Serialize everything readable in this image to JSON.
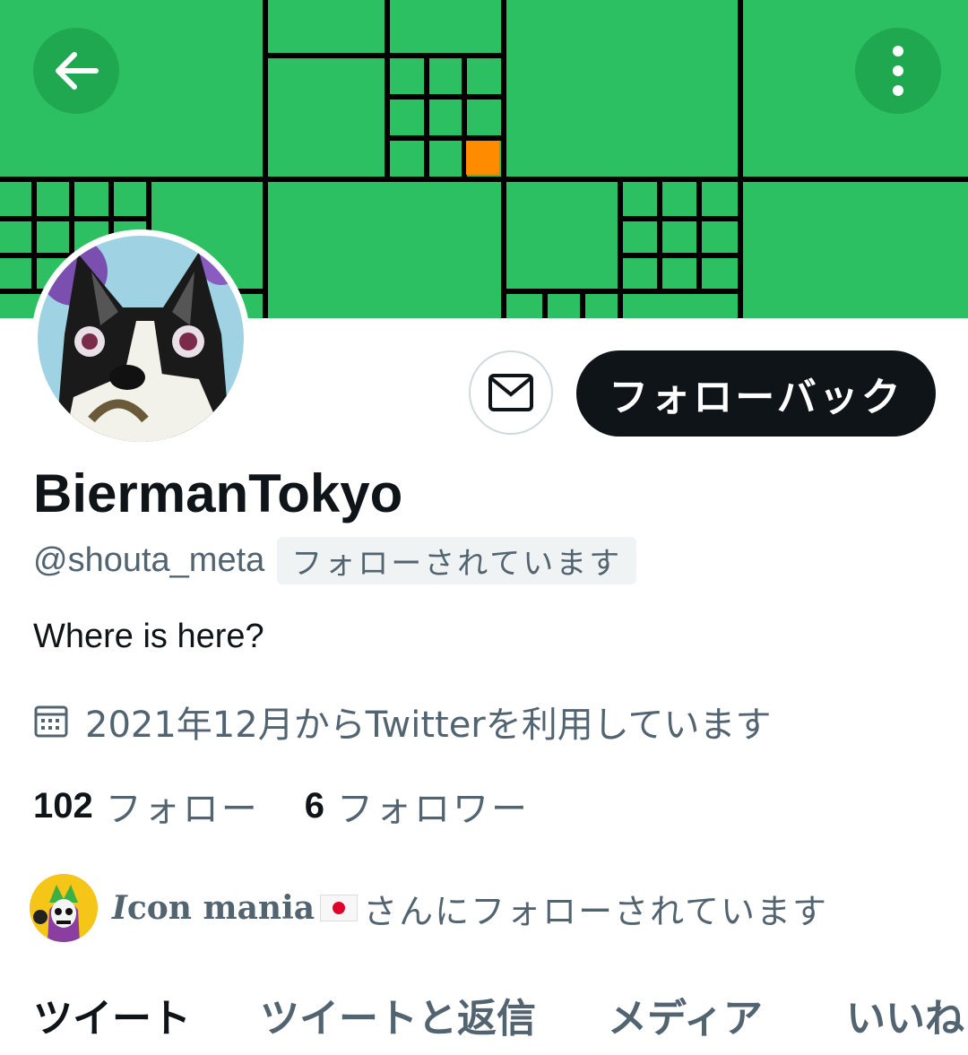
{
  "colors": {
    "banner_green": "#2dc063",
    "grid_line": "#000000",
    "accent_square": "#ff8c00",
    "follow_button_bg": "#0f1419",
    "secondary_text": "#536471"
  },
  "header": {
    "back_icon": "arrow-left-icon",
    "more_icon": "vertical-dots-icon"
  },
  "profile": {
    "display_name": "BiermanTokyo",
    "handle": "@shouta_meta",
    "follows_you": "フォローされています",
    "bio": "Where is here?",
    "joined": "2021年12月からTwitterを利用しています",
    "following_count": "102",
    "following_label": "フォロー",
    "followers_count": "6",
    "followers_label": "フォロワー"
  },
  "actions": {
    "message_icon": "envelope-icon",
    "follow_back_label": "フォローバック"
  },
  "followed_by": {
    "name_first": "I",
    "name_rest": "con mania",
    "flag": "japan-flag",
    "suffix": "さんにフォローされています"
  },
  "tabs": [
    {
      "label": "ツイート",
      "active": true
    },
    {
      "label": "ツイートと返信",
      "active": false
    },
    {
      "label": "メディア",
      "active": false
    },
    {
      "label": "いいね",
      "active": false
    }
  ]
}
